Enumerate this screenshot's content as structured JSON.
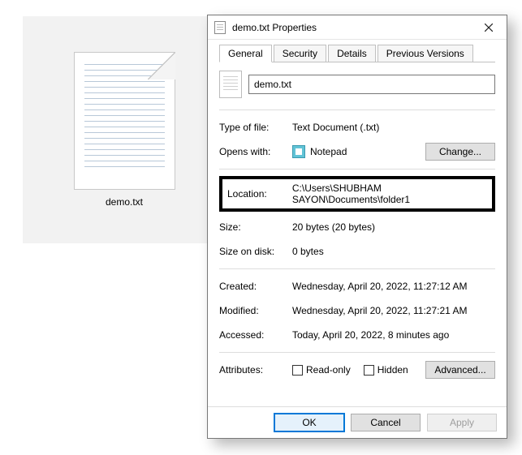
{
  "desktop": {
    "file_caption": "demo.txt"
  },
  "dialog": {
    "title": "demo.txt Properties",
    "tabs": {
      "general": "General",
      "security": "Security",
      "details": "Details",
      "previous": "Previous Versions"
    },
    "filename": "demo.txt",
    "labels": {
      "type_of_file": "Type of file:",
      "opens_with": "Opens with:",
      "location": "Location:",
      "size": "Size:",
      "size_on_disk": "Size on disk:",
      "created": "Created:",
      "modified": "Modified:",
      "accessed": "Accessed:",
      "attributes": "Attributes:",
      "readonly": "Read-only",
      "hidden": "Hidden"
    },
    "values": {
      "type_of_file": "Text Document (.txt)",
      "opens_with": "Notepad",
      "location": "C:\\Users\\SHUBHAM SAYON\\Documents\\folder1",
      "size": "20 bytes (20 bytes)",
      "size_on_disk": "0 bytes",
      "created": "Wednesday, April 20, 2022, 11:27:12 AM",
      "modified": "Wednesday, April 20, 2022, 11:27:21 AM",
      "accessed": "Today, April 20, 2022, 8 minutes ago"
    },
    "buttons": {
      "change": "Change...",
      "advanced": "Advanced...",
      "ok": "OK",
      "cancel": "Cancel",
      "apply": "Apply"
    }
  }
}
